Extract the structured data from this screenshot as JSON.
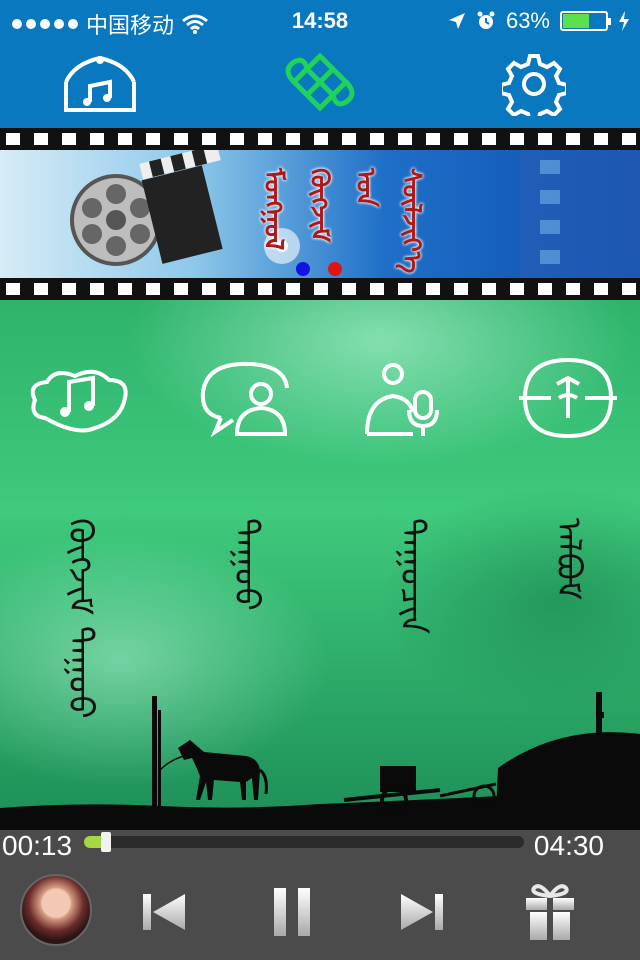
{
  "status_bar": {
    "carrier": "中国移动",
    "time": "14:58",
    "battery_percent": "63%",
    "battery_level": 0.63,
    "icons": [
      "signal-dots-icon",
      "wifi-icon",
      "location-arrow-icon",
      "alarm-icon",
      "battery-icon",
      "charging-bolt-icon"
    ]
  },
  "top_nav": {
    "items": [
      {
        "name": "music-home",
        "icon": "yurt-music-icon",
        "active": false
      },
      {
        "name": "endless-knot",
        "icon": "endless-knot-icon",
        "active": true
      },
      {
        "name": "settings",
        "icon": "gear-icon",
        "active": false
      }
    ]
  },
  "banner": {
    "mongolian_text": "ᠮᠣᠩᠭᠣᠯ ᠬᠥᠭᠵᠢᠮ ᠤᠨ ᠰᠦᠯᠵᠢᠶ᠎ᠡ",
    "icons": [
      "film-reel-icon",
      "clapperboard-icon"
    ],
    "page_dots": [
      {
        "color": "#1414e0",
        "active": true
      },
      {
        "color": "#e01414",
        "active": false
      }
    ]
  },
  "categories": [
    {
      "icon": "music-note-icon",
      "label": "ᠬᠥᠭᠵᠢᠮ ᠳᠠᠭᠤᠤ"
    },
    {
      "icon": "chat-person-icon",
      "label": "ᠳᠠᠭᠤᠤ"
    },
    {
      "icon": "singer-microphone-icon",
      "label": "ᠳᠠᠭᠤᠴᠢᠨ"
    },
    {
      "icon": "ornament-circle-icon",
      "label": "ᠠᠯᠪᠤᠮ"
    }
  ],
  "player": {
    "current_time": "00:13",
    "total_time": "04:30",
    "progress": 0.05,
    "controls": [
      "previous-icon",
      "pause-icon",
      "next-icon",
      "gift-icon"
    ]
  },
  "colors": {
    "nav_bar": "#0a78bf",
    "active_nav_icon": "#1fd35a",
    "player_bg": "#4b4b4b",
    "progress_fill": "#a4d93f"
  }
}
